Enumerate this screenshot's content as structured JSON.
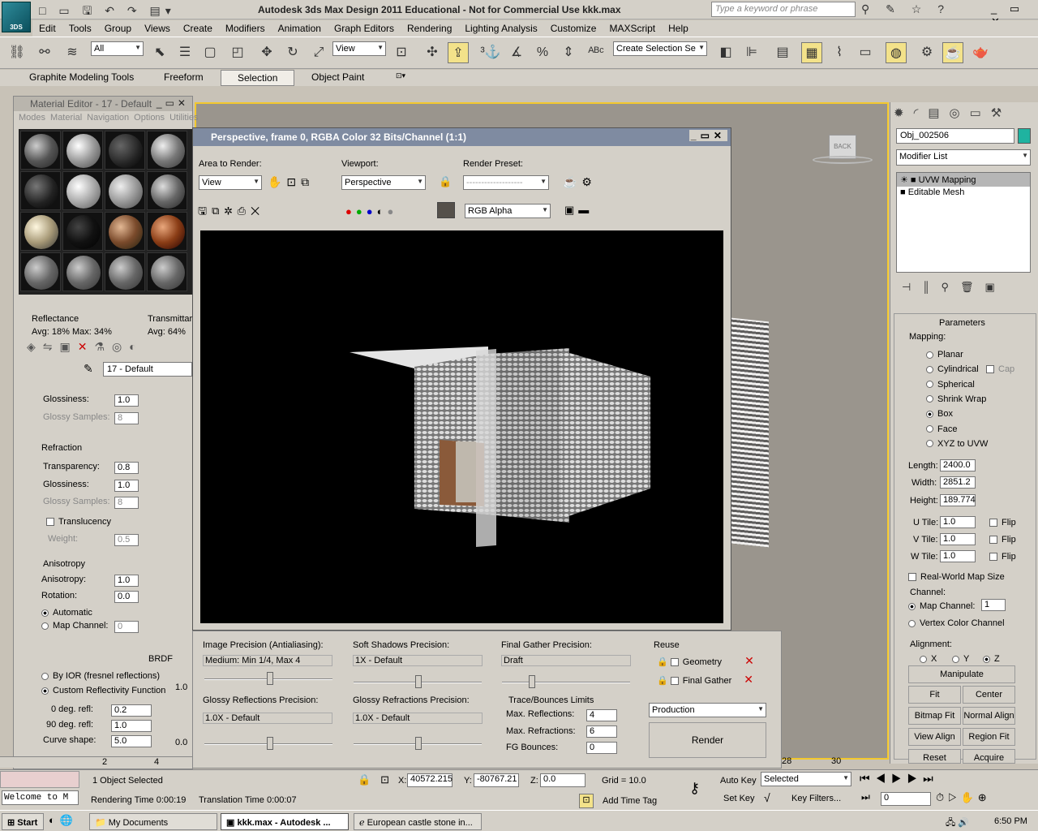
{
  "window": {
    "title": "Autodesk 3ds Max Design 2011   Educational - Not for Commercial Use    kkk.max",
    "logo": "3DS",
    "search_placeholder": "Type a keyword or phrase"
  },
  "menu": [
    "Edit",
    "Tools",
    "Group",
    "Views",
    "Create",
    "Modifiers",
    "Animation",
    "Graph Editors",
    "Rendering",
    "Lighting Analysis",
    "Customize",
    "MAXScript",
    "Help"
  ],
  "toolbar": {
    "filter": "All",
    "refcoord": "View",
    "selset": "Create Selection Se"
  },
  "ribbon": [
    "Graphite Modeling Tools",
    "Freeform",
    "Selection",
    "Object Paint"
  ],
  "material_editor": {
    "title": "Material Editor - 17 - Default",
    "menus": [
      "Modes",
      "Material",
      "Navigation",
      "Options",
      "Utilities"
    ],
    "reflectance": "Reflectance",
    "refl_avg": "Avg: 18% Max: 34%",
    "transmit": "Transmittar",
    "trans_avg": "Avg: 64%",
    "mat_name": "17 - Default",
    "glossiness": "Glossiness:",
    "gloss_val": "1.0",
    "glossy_samples": "Glossy Samples:",
    "gs_val": "8",
    "refraction": "Refraction",
    "transparency": "Transparency:",
    "trans_val": "0.8",
    "r_gloss_val": "1.0",
    "r_gs_val": "8",
    "translucency": "Translucency",
    "weight": "Weight:",
    "weight_val": "0.5",
    "anisotropy_group": "Anisotropy",
    "anisotropy": "Anisotropy:",
    "aniso_val": "1.0",
    "rotation": "Rotation:",
    "rot_val": "0.0",
    "automatic": "Automatic",
    "map_channel": "Map Channel:",
    "map_val": "0",
    "brdf": "BRDF",
    "by_ior": "By IOR (fresnel reflections)",
    "custom": "Custom Reflectivity Function",
    "deg0": "0 deg. refl:",
    "deg0_val": "0.2",
    "deg90": "90 deg. refl:",
    "deg90_val": "1.0",
    "curve": "Curve shape:",
    "curve_val": "5.0",
    "c1": "1.0",
    "c2": "0.0"
  },
  "render": {
    "title": "Perspective, frame 0, RGBA Color 32 Bits/Channel (1:1)",
    "area_label": "Area to Render:",
    "area_val": "View",
    "viewport_label": "Viewport:",
    "viewport_val": "Perspective",
    "preset_label": "Render Preset:",
    "preset_val": "-------------------",
    "channel": "RGB Alpha"
  },
  "render_settings": {
    "img_prec": "Image Precision (Antialiasing):",
    "img_val": "Medium: Min 1/4, Max 4",
    "soft": "Soft Shadows Precision:",
    "soft_val": "1X - Default",
    "fg": "Final Gather Precision:",
    "fg_val": "Draft",
    "reuse": "Reuse",
    "geometry": "Geometry",
    "final_gather": "Final Gather",
    "glossy_refl": "Glossy Reflections Precision:",
    "gr_val": "1.0X - Default",
    "glossy_refr": "Glossy Refractions Precision:",
    "grr_val": "1.0X - Default",
    "trace": "Trace/Bounces Limits",
    "max_refl": "Max. Reflections:",
    "max_refl_val": "4",
    "max_refr": "Max. Refractions:",
    "max_refr_val": "6",
    "fg_bounces": "FG Bounces:",
    "fgb_val": "0",
    "production": "Production",
    "render_btn": "Render"
  },
  "command_panel": {
    "obj_name": "Obj_002506",
    "modifier_list": "Modifier List",
    "stack": [
      "UVW Mapping",
      "Editable Mesh"
    ],
    "parameters": "Parameters",
    "mapping": "Mapping:",
    "mappings": [
      "Planar",
      "Cylindrical",
      "Spherical",
      "Shrink Wrap",
      "Box",
      "Face",
      "XYZ to UVW"
    ],
    "cap": "Cap",
    "length": "Length:",
    "length_val": "2400.0",
    "width": "Width:",
    "width_val": "2851.2",
    "height": "Height:",
    "height_val": "189.774",
    "utile": "U Tile:",
    "utile_val": "1.0",
    "vtile": "V Tile:",
    "vtile_val": "1.0",
    "wtile": "W Tile:",
    "wtile_val": "1.0",
    "flip": "Flip",
    "realworld": "Real-World Map Size",
    "channel": "Channel:",
    "mapch": "Map Channel:",
    "mapch_val": "1",
    "vertex": "Vertex Color Channel",
    "alignment": "Alignment:",
    "x": "X",
    "y": "Y",
    "z": "Z",
    "manipulate": "Manipulate",
    "fit": "Fit",
    "center": "Center",
    "bitmap_fit": "Bitmap Fit",
    "normal_align": "Normal Align",
    "view_align": "View Align",
    "region_fit": "Region Fit",
    "reset": "Reset",
    "acquire": "Acquire"
  },
  "viewcube": "BACK",
  "timeline": {
    "t1": "2",
    "t2": "4",
    "t3": "28",
    "t4": "30"
  },
  "status": {
    "welcome": "Welcome to M",
    "selected": "1 Object Selected",
    "render_time": "Rendering Time  0:00:19",
    "trans_time": "Translation Time  0:00:07",
    "x_label": "X:",
    "x": "40572.215",
    "y_label": "Y:",
    "y": "-80767.21",
    "z_label": "Z:",
    "z": "0.0",
    "grid": "Grid = 10.0",
    "add_time_tag": "Add Time Tag",
    "auto_key": "Auto Key",
    "set_key": "Set Key",
    "selected_dd": "Selected",
    "key_filters": "Key Filters...",
    "frame": "0"
  },
  "taskbar": {
    "start": "Start",
    "tasks": [
      "My Documents",
      "kkk.max - Autodesk ...",
      "European castle stone in..."
    ],
    "clock": "6:50 PM"
  }
}
